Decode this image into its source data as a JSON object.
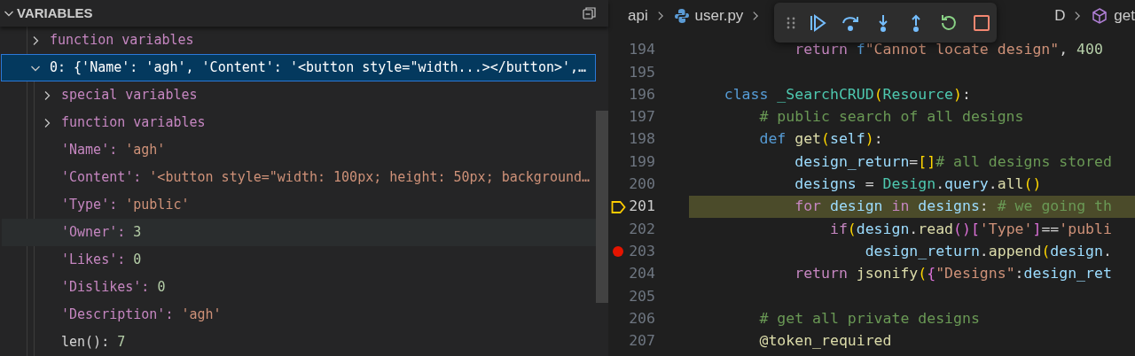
{
  "variables": {
    "title": "VARIABLES",
    "expanded": true,
    "items": [
      {
        "kind": "group",
        "label": "function variables",
        "expanded": false,
        "selected": false
      },
      {
        "kind": "group",
        "label": "0: {'Name': 'agh', 'Content': '<button style=\"width...></button>',…",
        "expanded": true,
        "selected": true,
        "children": [
          {
            "kind": "group",
            "label": "special variables",
            "expanded": false,
            "selected": false,
            "highlighted": false
          },
          {
            "kind": "group",
            "label": "function variables",
            "expanded": false,
            "selected": false,
            "highlighted": false
          },
          {
            "kind": "string",
            "name": "'Name':",
            "value": "'agh'",
            "selected": false,
            "highlighted": false
          },
          {
            "kind": "string",
            "name": "'Content':",
            "value": "'<button style=\"width: 100px; height: 50px; background…",
            "selected": false,
            "highlighted": false
          },
          {
            "kind": "string",
            "name": "'Type':",
            "value": "'public'",
            "selected": false,
            "highlighted": false
          },
          {
            "kind": "number",
            "name": "'Owner':",
            "value": "3",
            "selected": false,
            "highlighted": true
          },
          {
            "kind": "number",
            "name": "'Likes':",
            "value": "0",
            "selected": false,
            "highlighted": false
          },
          {
            "kind": "number",
            "name": "'Dislikes':",
            "value": "0",
            "selected": false,
            "highlighted": false
          },
          {
            "kind": "string",
            "name": "'Description':",
            "value": "'agh'",
            "selected": false,
            "highlighted": false
          },
          {
            "kind": "builtin",
            "name": "len():",
            "value": "7",
            "selected": false,
            "highlighted": false
          }
        ]
      }
    ]
  },
  "breadcrumbs": [
    {
      "kind": "folder",
      "label": "api"
    },
    {
      "kind": "python",
      "label": "user.py"
    },
    {
      "kind": "text",
      "label": "D"
    },
    {
      "kind": "method",
      "label": "get"
    }
  ],
  "debug_toolbar": [
    {
      "kind": "continue"
    },
    {
      "kind": "step_over"
    },
    {
      "kind": "step_into"
    },
    {
      "kind": "step_out"
    },
    {
      "kind": "restart"
    },
    {
      "kind": "stop"
    }
  ],
  "editor": {
    "lines": [
      {
        "number": "194",
        "kind": "plain",
        "tokens": [
          {
            "t": "            return ",
            "kind": "kw"
          },
          {
            "t": "f",
            "kind": "storage"
          },
          {
            "t": "\"Cannot locate design\"",
            "kind": "string"
          },
          {
            "t": ", ",
            "kind": "punct"
          },
          {
            "t": "400",
            "kind": "number"
          }
        ]
      },
      {
        "number": "195",
        "kind": "plain"
      },
      {
        "number": "196",
        "kind": "plain",
        "tokens": [
          {
            "t": "    class ",
            "kind": "storage"
          },
          {
            "t": "_SearchCRUD",
            "kind": "type"
          },
          {
            "t": "(",
            "kind": "b1"
          },
          {
            "t": "Resource",
            "kind": "type"
          },
          {
            "t": ")",
            "kind": "b1"
          },
          {
            "t": ":",
            "kind": "punct"
          }
        ]
      },
      {
        "number": "197",
        "kind": "plain",
        "tokens": [
          {
            "t": "        # public search of all designs",
            "kind": "comment"
          }
        ]
      },
      {
        "number": "198",
        "kind": "plain",
        "tokens": [
          {
            "t": "        def ",
            "kind": "storage"
          },
          {
            "t": "get",
            "kind": "func"
          },
          {
            "t": "(",
            "kind": "b1"
          },
          {
            "t": "self",
            "kind": "var"
          },
          {
            "t": ")",
            "kind": "b1"
          },
          {
            "t": ":",
            "kind": "punct"
          }
        ]
      },
      {
        "number": "199",
        "kind": "plain",
        "tokens": [
          {
            "t": "            design_return",
            "kind": "var"
          },
          {
            "t": "=",
            "kind": "punct"
          },
          {
            "t": "[]",
            "kind": "b1"
          },
          {
            "t": "# all designs stored",
            "kind": "comment"
          }
        ]
      },
      {
        "number": "200",
        "kind": "plain",
        "tokens": [
          {
            "t": "            designs",
            "kind": "var"
          },
          {
            "t": " = ",
            "kind": "punct"
          },
          {
            "t": "Design",
            "kind": "type"
          },
          {
            "t": ".",
            "kind": "punct"
          },
          {
            "t": "query",
            "kind": "var"
          },
          {
            "t": ".",
            "kind": "punct"
          },
          {
            "t": "all",
            "kind": "func"
          },
          {
            "t": "()",
            "kind": "b1"
          }
        ]
      },
      {
        "number": "201",
        "kind": "current",
        "tokens": [
          {
            "t": "            for ",
            "kind": "kw"
          },
          {
            "t": "design ",
            "kind": "var"
          },
          {
            "t": "in ",
            "kind": "kw"
          },
          {
            "t": "designs",
            "kind": "var"
          },
          {
            "t": ": ",
            "kind": "punct"
          },
          {
            "t": "# we going th",
            "kind": "comment"
          }
        ]
      },
      {
        "number": "202",
        "kind": "plain",
        "tokens": [
          {
            "t": "                if",
            "kind": "kw"
          },
          {
            "t": "(",
            "kind": "b1"
          },
          {
            "t": "design",
            "kind": "var"
          },
          {
            "t": ".",
            "kind": "punct"
          },
          {
            "t": "read",
            "kind": "func"
          },
          {
            "t": "()",
            "kind": "b2"
          },
          {
            "t": "[",
            "kind": "b2"
          },
          {
            "t": "'Type'",
            "kind": "string"
          },
          {
            "t": "]",
            "kind": "b2"
          },
          {
            "t": "==",
            "kind": "punct"
          },
          {
            "t": "'publi",
            "kind": "string"
          }
        ]
      },
      {
        "number": "203",
        "kind": "breakpoint",
        "tokens": [
          {
            "t": "                    design_return",
            "kind": "var"
          },
          {
            "t": ".",
            "kind": "punct"
          },
          {
            "t": "append",
            "kind": "func"
          },
          {
            "t": "(",
            "kind": "b1"
          },
          {
            "t": "design",
            "kind": "var"
          },
          {
            "t": ".",
            "kind": "punct"
          }
        ]
      },
      {
        "number": "204",
        "kind": "plain",
        "tokens": [
          {
            "t": "            return ",
            "kind": "kw"
          },
          {
            "t": "jsonify",
            "kind": "func"
          },
          {
            "t": "(",
            "kind": "b1"
          },
          {
            "t": "{",
            "kind": "b2"
          },
          {
            "t": "\"Designs\"",
            "kind": "string"
          },
          {
            "t": ":",
            "kind": "punct"
          },
          {
            "t": "design_ret",
            "kind": "var"
          }
        ]
      },
      {
        "number": "205",
        "kind": "plain"
      },
      {
        "number": "206",
        "kind": "plain",
        "tokens": [
          {
            "t": "        # get all private designs",
            "kind": "comment"
          }
        ]
      },
      {
        "number": "207",
        "kind": "plain",
        "tokens": [
          {
            "t": "        @token_required",
            "kind": "func"
          }
        ]
      }
    ]
  }
}
